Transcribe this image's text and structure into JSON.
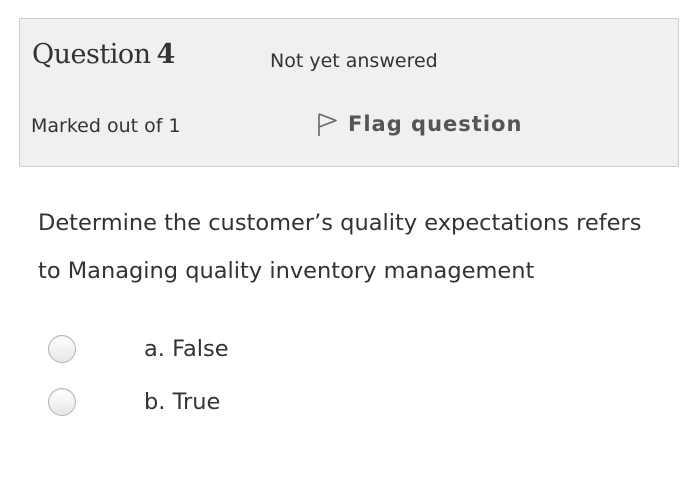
{
  "question": {
    "label": "Question",
    "number": "4",
    "state": "Not yet answered",
    "grade": "Marked out of 1",
    "flag_label": "Flag question",
    "flag_icon": "flag-outline-icon",
    "text": "Determine the customer’s quality expectations refers to Managing quality inventory management"
  },
  "answers": [
    {
      "label": "a. False",
      "selected": false
    },
    {
      "label": "b. True",
      "selected": false
    }
  ],
  "colors": {
    "info_bg": "#f0f0f0",
    "info_border": "#cfcfcf",
    "text": "#333333"
  }
}
